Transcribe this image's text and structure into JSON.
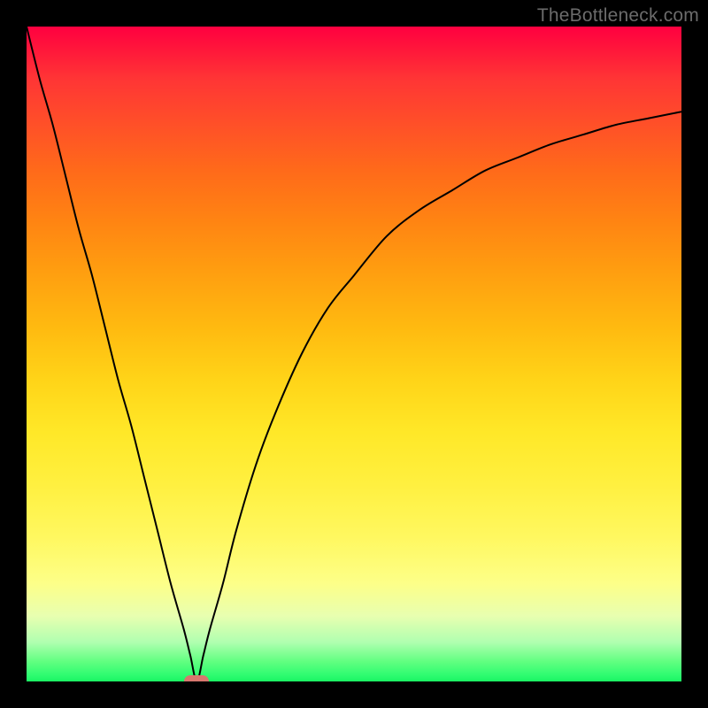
{
  "watermark": "TheBottleneck.com",
  "chart_data": {
    "type": "line",
    "title": "",
    "xlabel": "",
    "ylabel": "",
    "xlim": [
      0,
      100
    ],
    "ylim": [
      0,
      100
    ],
    "grid": false,
    "gradient_stops": [
      {
        "pct": 0,
        "color": "#ff0040"
      },
      {
        "pct": 50,
        "color": "#ffd418"
      },
      {
        "pct": 100,
        "color": "#1af563"
      }
    ],
    "minimum": {
      "x": 26,
      "y": 0,
      "marker_color": "#d8766e"
    },
    "series": [
      {
        "name": "bottleneck-curve",
        "color": "#000000",
        "width": 2,
        "x": [
          0,
          2,
          4,
          6,
          8,
          10,
          12,
          14,
          16,
          18,
          20,
          22,
          24,
          25,
          26,
          27,
          28,
          30,
          32,
          35,
          38,
          42,
          46,
          50,
          55,
          60,
          65,
          70,
          75,
          80,
          85,
          90,
          95,
          100
        ],
        "y": [
          100,
          92,
          85,
          77,
          69,
          62,
          54,
          46,
          39,
          31,
          23,
          15,
          8,
          4,
          0,
          4,
          8,
          15,
          23,
          33,
          41,
          50,
          57,
          62,
          68,
          72,
          75,
          78,
          80,
          82,
          83.5,
          85,
          86,
          87
        ]
      }
    ]
  }
}
